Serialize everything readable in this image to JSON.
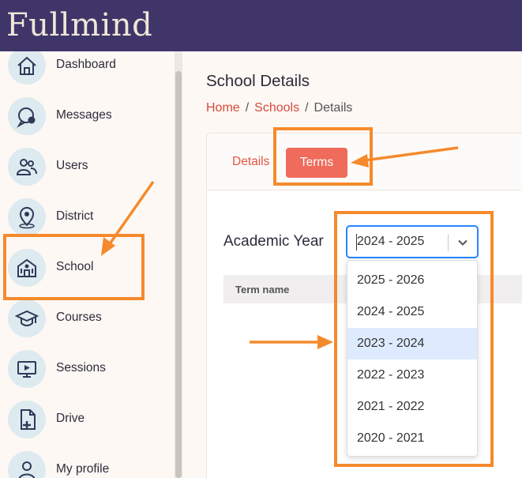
{
  "app": {
    "logo_text": "Fullmind",
    "accent": "#403569",
    "link_color": "#d64a3c",
    "tab_active_color": "#ef6b5c",
    "highlight_color": "#f58a2c"
  },
  "sidebar": {
    "items": [
      {
        "label": "Dashboard",
        "icon": "home-icon"
      },
      {
        "label": "Messages",
        "icon": "chat-icon"
      },
      {
        "label": "Users",
        "icon": "users-icon"
      },
      {
        "label": "District",
        "icon": "map-pin-icon"
      },
      {
        "label": "School",
        "icon": "school-icon"
      },
      {
        "label": "Courses",
        "icon": "graduation-cap-icon"
      },
      {
        "label": "Sessions",
        "icon": "video-screen-icon"
      },
      {
        "label": "Drive",
        "icon": "file-add-icon"
      },
      {
        "label": "My profile",
        "icon": "person-icon"
      }
    ]
  },
  "page": {
    "title": "School Details",
    "breadcrumb": {
      "home": "Home",
      "schools": "Schools",
      "current": "Details",
      "separator": "/"
    }
  },
  "tabs": {
    "details": "Details",
    "terms": "Terms"
  },
  "academic_year": {
    "label": "Academic Year",
    "selected": "2024 - 2025",
    "options": [
      "2025 - 2026",
      "2024 - 2025",
      "2023 - 2024",
      "2022 - 2023",
      "2021 - 2022",
      "2020 - 2021"
    ],
    "focused_option": "2023 - 2024"
  },
  "table": {
    "columns": [
      "Term name"
    ]
  }
}
